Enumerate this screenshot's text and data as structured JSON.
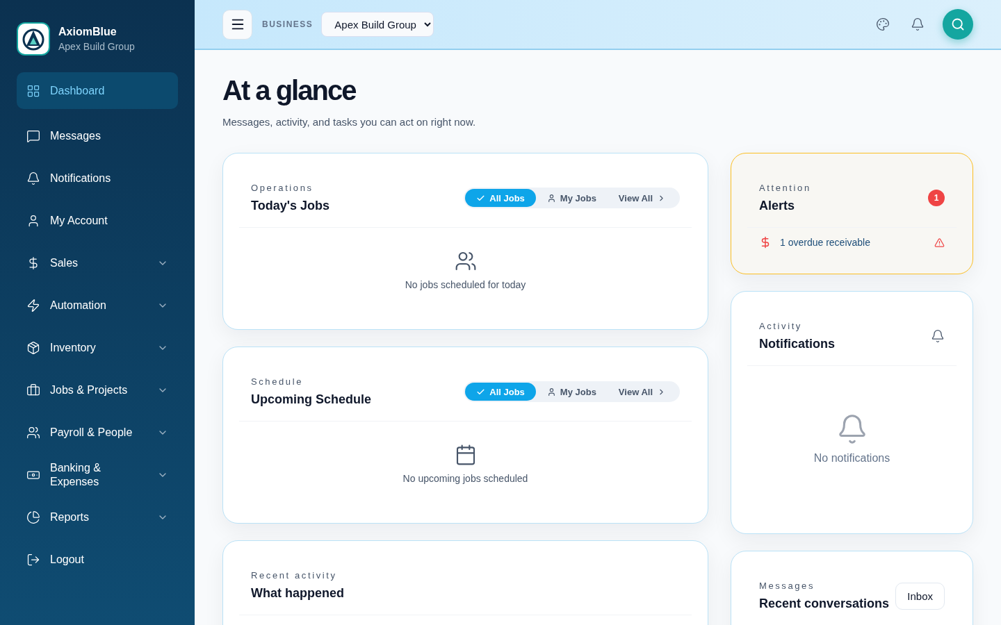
{
  "brand": {
    "name": "AxiomBlue",
    "subtitle": "Apex Build Group"
  },
  "sidebar": {
    "items": [
      {
        "label": "Dashboard",
        "selected": true,
        "expandable": false
      },
      {
        "label": "Messages",
        "selected": false,
        "expandable": false
      },
      {
        "label": "Notifications",
        "selected": false,
        "expandable": false
      },
      {
        "label": "My Account",
        "selected": false,
        "expandable": false
      },
      {
        "label": "Sales",
        "selected": false,
        "expandable": true
      },
      {
        "label": "Automation",
        "selected": false,
        "expandable": true
      },
      {
        "label": "Inventory",
        "selected": false,
        "expandable": true
      },
      {
        "label": "Jobs & Projects",
        "selected": false,
        "expandable": true
      },
      {
        "label": "Payroll & People",
        "selected": false,
        "expandable": true
      },
      {
        "label": "Banking & Expenses",
        "selected": false,
        "expandable": true
      },
      {
        "label": "Reports",
        "selected": false,
        "expandable": true
      },
      {
        "label": "Logout",
        "selected": false,
        "expandable": false
      }
    ]
  },
  "topbar": {
    "business_label": "BUSINESS",
    "business_select": "Apex Build Group"
  },
  "page": {
    "title": "At a glance",
    "subtitle": "Messages, activity, and tasks you can act on right now."
  },
  "left_cards": [
    {
      "eyebrow": "Operations",
      "title": "Today's Jobs",
      "filters": [
        {
          "label": "All Jobs",
          "selected": true
        },
        {
          "label": "My Jobs",
          "selected": false
        }
      ],
      "link": "View All",
      "empty": "No jobs scheduled for today"
    },
    {
      "eyebrow": "Schedule",
      "title": "Upcoming Schedule",
      "filters": [
        {
          "label": "All Jobs",
          "selected": true
        },
        {
          "label": "My Jobs",
          "selected": false
        }
      ],
      "link": "View All",
      "empty": "No upcoming jobs scheduled"
    },
    {
      "eyebrow": "Recent activity",
      "title": "What happened"
    }
  ],
  "alerts": {
    "eyebrow": "Attention",
    "title": "Alerts",
    "count": "1",
    "items": [
      {
        "text": "1 overdue receivable"
      }
    ]
  },
  "notifications": {
    "eyebrow": "Activity",
    "title": "Notifications",
    "empty": "No notifications"
  },
  "messages": {
    "eyebrow": "Messages",
    "title": "Recent conversations",
    "button": "Inbox"
  }
}
